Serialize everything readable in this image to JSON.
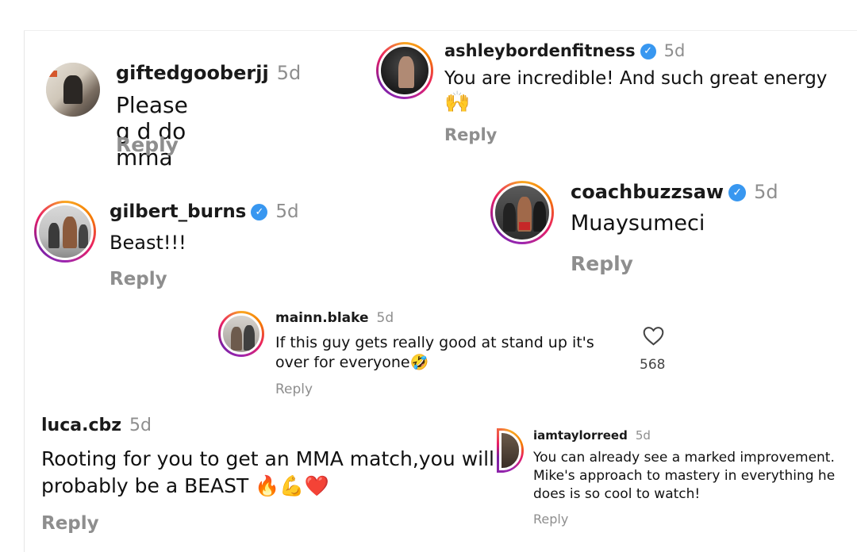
{
  "comments": [
    {
      "id": "giftedgooberjj",
      "username": "giftedgooberjj",
      "time": "5d",
      "text": "Please g d do mma",
      "reply": "Reply",
      "verified": false
    },
    {
      "id": "ashleybordenfitness",
      "username": "ashleybordenfitness",
      "time": "5d",
      "text": "You are incredible! And such great energy",
      "emoji": "🙌",
      "reply": "Reply",
      "verified": true
    },
    {
      "id": "gilbert_burns",
      "username": "gilbert_burns",
      "time": "5d",
      "text": "Beast!!!",
      "reply": "Reply",
      "verified": true
    },
    {
      "id": "coachbuzzsaw",
      "username": "coachbuzzsaw",
      "time": "5d",
      "text": "Muaysumeci",
      "reply": "Reply",
      "verified": true
    },
    {
      "id": "mainn.blake",
      "username": "mainn.blake",
      "time": "5d",
      "text": "If this guy gets really good at stand up it's over for everyone",
      "emoji": "🤣",
      "reply": "Reply",
      "likes": "568",
      "verified": false
    },
    {
      "id": "luca.cbz",
      "username": "luca.cbz",
      "time": "5d",
      "text": "Rooting for you to get an MMA match,you will probably be a BEAST",
      "emoji": "🔥💪❤️",
      "reply": "Reply",
      "verified": false
    },
    {
      "id": "iamtaylorreed",
      "username": "iamtaylorreed",
      "time": "5d",
      "text": "You can already see a marked improvement. Mike's approach to mastery in everything he does is so cool to watch!",
      "reply": "Reply",
      "verified": false
    }
  ],
  "icons": {
    "verified": "verified-badge-icon",
    "like": "heart-icon"
  },
  "colors": {
    "verified_blue": "#3897f0",
    "muted_gray": "#8e8e8e"
  }
}
